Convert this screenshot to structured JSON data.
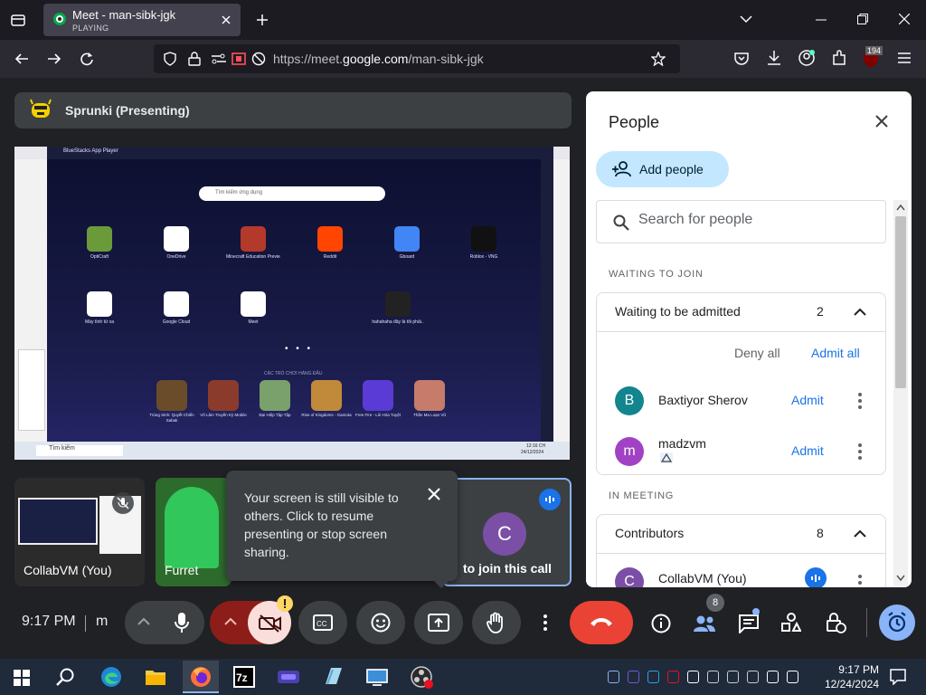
{
  "browser": {
    "tab_title": "Meet - man-sibk-jgk",
    "tab_status": "PLAYING",
    "url_prefix": "https://meet.",
    "url_domain": "google.com",
    "url_path": "/man-sibk-jgk",
    "badge_count": "194"
  },
  "meet": {
    "presenter_label": "Sprunki (Presenting)",
    "tiles": [
      {
        "label": "CollabVM (You)"
      },
      {
        "label": "Furret"
      },
      {
        "label": "to join this call",
        "avatar_letter": "C"
      }
    ],
    "toast": {
      "message": "Your screen is still visible to others. Click to resume presenting or stop screen sharing."
    },
    "meeting_time": "9:17 PM",
    "meeting_code_partial": "m",
    "people_badge": "8"
  },
  "people_panel": {
    "title": "People",
    "add_people_label": "Add people",
    "search_placeholder": "Search for people",
    "waiting_section": "WAITING TO JOIN",
    "waiting_card": {
      "label": "Waiting to be admitted",
      "count": "2",
      "deny_all": "Deny all",
      "admit_all": "Admit all",
      "people": [
        {
          "initial": "B",
          "name": "Baxtiyor Sherov",
          "action": "Admit",
          "color": "#12858f"
        },
        {
          "initial": "m",
          "name": "madzvm",
          "action": "Admit",
          "color": "#a142c4"
        }
      ]
    },
    "in_meeting_section": "IN MEETING",
    "contributors_card": {
      "label": "Contributors",
      "count": "8",
      "first_person": "CollabVM (You)",
      "first_initial": "C"
    }
  },
  "shared_screen": {
    "window_title": "BlueStacks App Player",
    "search_placeholder": "Tìm kiếm ứng dụng",
    "apps_row1": [
      "OptiCraft",
      "OneDrive",
      "Minecraft Education Previe...",
      "Reddit",
      "Gboard",
      "Roblox - VNG"
    ],
    "apps_row2": [
      "Máy tính từ xa",
      "Google Cloud",
      "Meet",
      "hahahaha đây là tôi phải.."
    ],
    "games_row": [
      "Trùng Sinh: Quyết Chiến Sabak",
      "Võ Lâm Truyền Kỳ Mobile",
      "Đại Hiệp Tập Tập",
      "Rise of Kingdoms - Gamota",
      "Free Fire - Lôi Hỏa Tuyệt",
      "Thần Ma Loạn Vũ"
    ],
    "section_label": "CÁC TRÒ CHƠI HÀNG ĐẦU",
    "taskbar_search": "Tìm kiếm",
    "clock": "12:16 CH",
    "date": "24/12/2024"
  },
  "taskbar": {
    "time": "9:17 PM",
    "date": "12/24/2024"
  },
  "colors": {
    "meet_bg": "#202124",
    "end_call": "#ea4335",
    "accent_blue": "#1a73e8",
    "camera_off": "#f9dedc"
  }
}
